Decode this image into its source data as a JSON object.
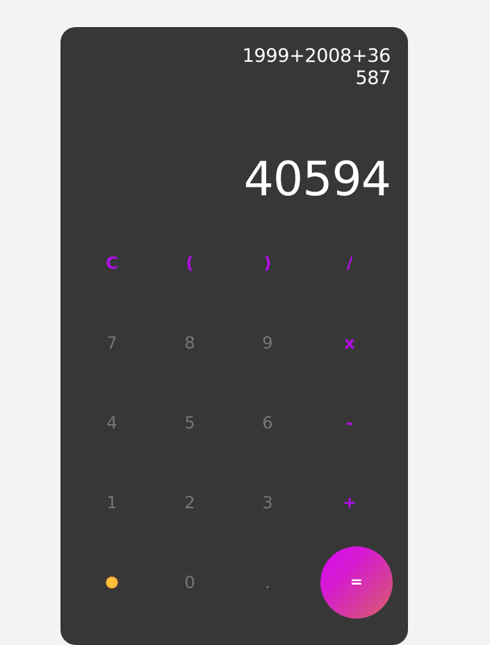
{
  "display": {
    "expression": "1999+2008+36587",
    "result": "40594"
  },
  "keys": {
    "clear": "C",
    "open_paren": "(",
    "close_paren": ")",
    "divide": "/",
    "seven": "7",
    "eight": "8",
    "nine": "9",
    "multiply": "x",
    "four": "4",
    "five": "5",
    "six": "6",
    "subtract": "-",
    "one": "1",
    "two": "2",
    "three": "3",
    "add": "+",
    "zero": "0",
    "decimal": ".",
    "equals": "="
  },
  "colors": {
    "panel": "#373737",
    "accent": "#b10ee6",
    "digit": "#777777",
    "sun": "#fbbf3a",
    "sun_border": "#f08a32"
  },
  "icons": {
    "theme_toggle": "sun-icon"
  }
}
